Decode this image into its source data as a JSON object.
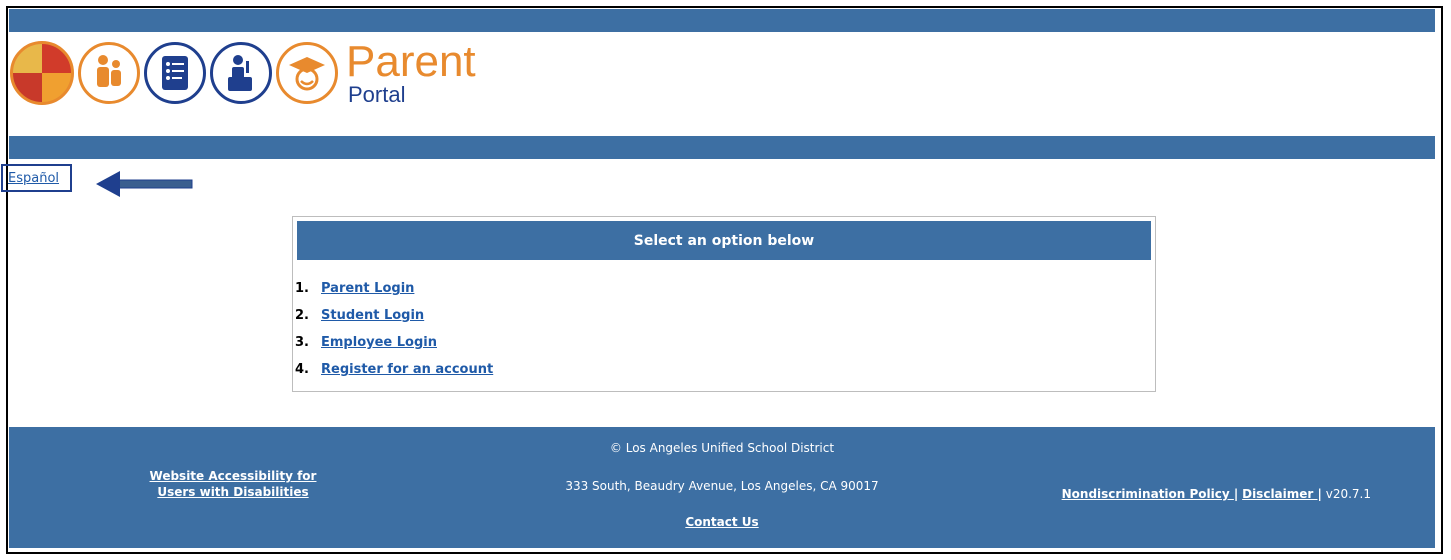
{
  "brand": {
    "title": "Parent",
    "subtitle": "Portal"
  },
  "language_link": "Español",
  "panel": {
    "header": "Select an option below",
    "options": [
      {
        "num": "1.",
        "label": "Parent Login"
      },
      {
        "num": "2.",
        "label": "Student Login"
      },
      {
        "num": "3.",
        "label": "Employee Login"
      },
      {
        "num": "4.",
        "label": "Register for an account"
      }
    ]
  },
  "footer": {
    "copyright": "© Los Angeles Unified School District",
    "address": "333 South, Beaudry Avenue, Los Angeles, CA 90017",
    "contact": "Contact Us",
    "accessibility": "Website Accessibility for Users with Disabilities",
    "nondiscrimination": "Nondiscrimination Policy ",
    "disclaimer": "Disclaimer ",
    "version": " v20.7.1"
  },
  "colors": {
    "bar_blue": "#3d6fa3",
    "brand_orange": "#e88a2e",
    "brand_navy": "#1f3f8e",
    "link_blue": "#1f5aa8"
  },
  "icons": [
    "district-seal-icon",
    "family-icon",
    "report-card-icon",
    "teacher-icon",
    "graduate-icon",
    "arrow-left-icon"
  ]
}
